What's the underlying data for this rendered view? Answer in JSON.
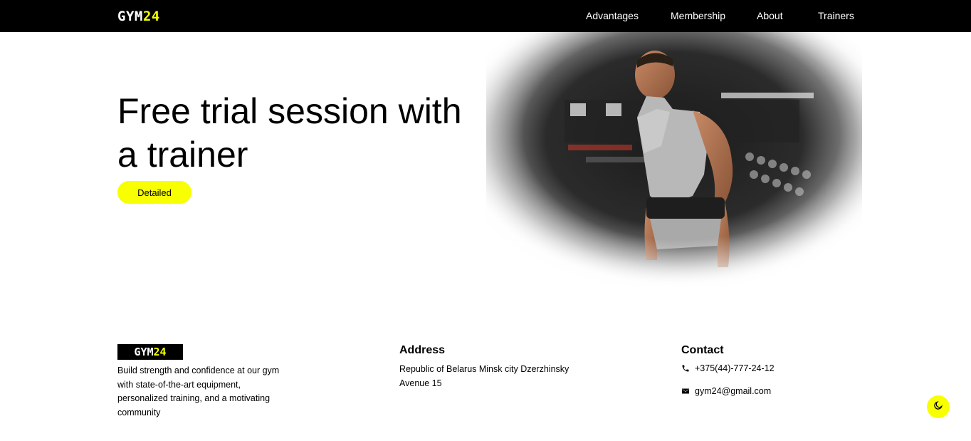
{
  "header": {
    "logo": {
      "part1": "GYM",
      "part2": "24"
    },
    "nav": [
      {
        "label": "Advantages"
      },
      {
        "label": "Membership"
      },
      {
        "label": "About"
      },
      {
        "label": "Trainers"
      }
    ]
  },
  "hero": {
    "title": "Free trial session with a trainer",
    "button_label": "Detailed",
    "image_icon": "trainer-photo"
  },
  "footer": {
    "logo": {
      "part1": "GYM",
      "part2": "24"
    },
    "description": "Build strength and confidence at our gym with state-of-the-art equipment, personalized training, and a motivating community",
    "address": {
      "heading": "Address",
      "text": "Republic of Belarus Minsk city Dzerzhinsky Avenue 15"
    },
    "contact": {
      "heading": "Contact",
      "phone": "+375(44)-777-24-12",
      "email": "gym24@gmail.com",
      "phone_icon": "phone-icon",
      "email_icon": "envelope-icon"
    }
  },
  "theme_toggle": {
    "icon": "moon-icon"
  },
  "colors": {
    "accent": "#f7ff00",
    "header_bg": "#000000",
    "background": "#ffffff"
  }
}
